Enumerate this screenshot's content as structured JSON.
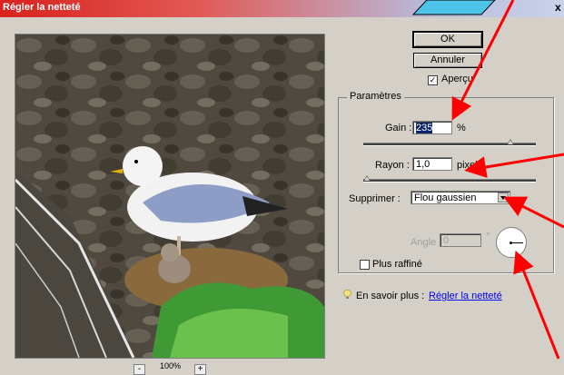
{
  "window": {
    "title": "Régler la netteté",
    "close_glyph": "x"
  },
  "buttons": {
    "ok": "OK",
    "cancel": "Annuler"
  },
  "preview_checkbox": {
    "label": "Aperçu",
    "checked": true
  },
  "group": {
    "title": "Paramètres"
  },
  "gain": {
    "label": "Gain :",
    "value": "235",
    "unit": "%",
    "slider_level_pct": 85
  },
  "radius": {
    "label": "Rayon :",
    "value": "1,0",
    "unit": "pixels",
    "slider_level_pct": 1
  },
  "remove": {
    "label": "Supprimer :",
    "selected": "Flou gaussien"
  },
  "angle": {
    "label": "Angle :",
    "value": "0",
    "unit": "°"
  },
  "refined_checkbox": {
    "label": "Plus raffiné",
    "checked": false
  },
  "learn_more": {
    "prefix": "En savoir plus :",
    "link": "Régler la netteté"
  },
  "zoom": {
    "minus": "-",
    "level": "100%",
    "plus": "+"
  },
  "colors": {
    "annotation_arrow": "#ff0000",
    "title_gradient_start": "#d9211d",
    "link": "#0000ee"
  },
  "icons": {
    "bulb": "lightbulb-icon",
    "dial": "angle-dial-icon"
  }
}
